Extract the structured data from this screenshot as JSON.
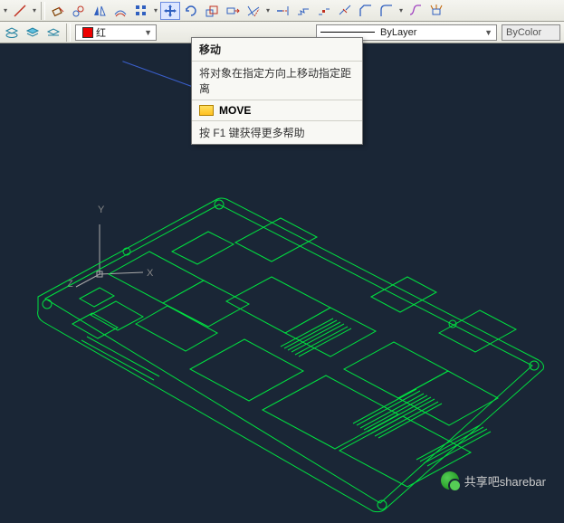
{
  "toolbar2": {
    "color_name": "红",
    "linetype_label": "ByLayer",
    "lineweight_label": "ByColor"
  },
  "tooltip": {
    "title": "移动",
    "description": "将对象在指定方向上移动指定距离",
    "command": "MOVE",
    "help": "按 F1 键获得更多帮助"
  },
  "axes": {
    "x": "X",
    "y": "Y",
    "z": "Z"
  },
  "watermark": {
    "text": "共享吧sharebar"
  }
}
